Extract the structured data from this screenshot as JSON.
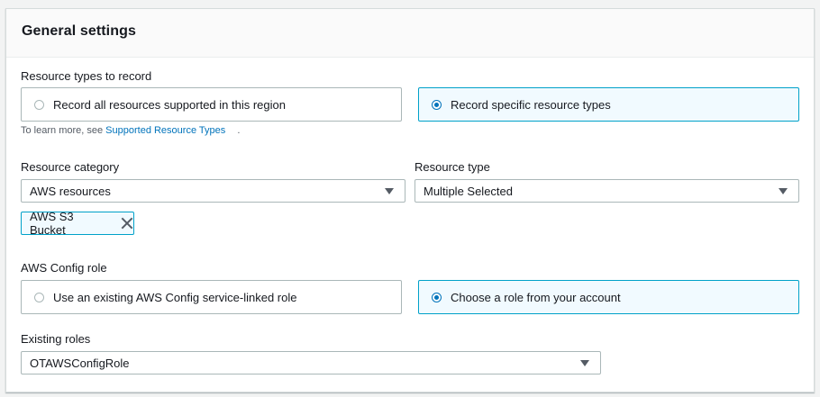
{
  "panel": {
    "title": "General settings"
  },
  "resource_types": {
    "label": "Resource types to record",
    "options": [
      {
        "label": "Record all resources supported in this region",
        "selected": false
      },
      {
        "label": "Record specific resource types",
        "selected": true
      }
    ],
    "help_prefix": "To learn more, see",
    "help_link": "Supported Resource Types",
    "help_suffix": "."
  },
  "resource_category": {
    "label": "Resource category",
    "value": "AWS resources"
  },
  "resource_type": {
    "label": "Resource type",
    "value": "Multiple Selected"
  },
  "selected_tokens": [
    {
      "label": "AWS S3 Bucket"
    }
  ],
  "config_role": {
    "label": "AWS Config role",
    "options": [
      {
        "label": "Use an existing AWS Config service-linked role",
        "selected": false
      },
      {
        "label": "Choose a role from your account",
        "selected": true
      }
    ]
  },
  "existing_roles": {
    "label": "Existing roles",
    "value": "OTAWSConfigRole"
  },
  "colors": {
    "accent": "#0073bb",
    "selected_border": "#00a1c9",
    "selected_bg": "#f1faff",
    "border": "#aab7b8"
  }
}
